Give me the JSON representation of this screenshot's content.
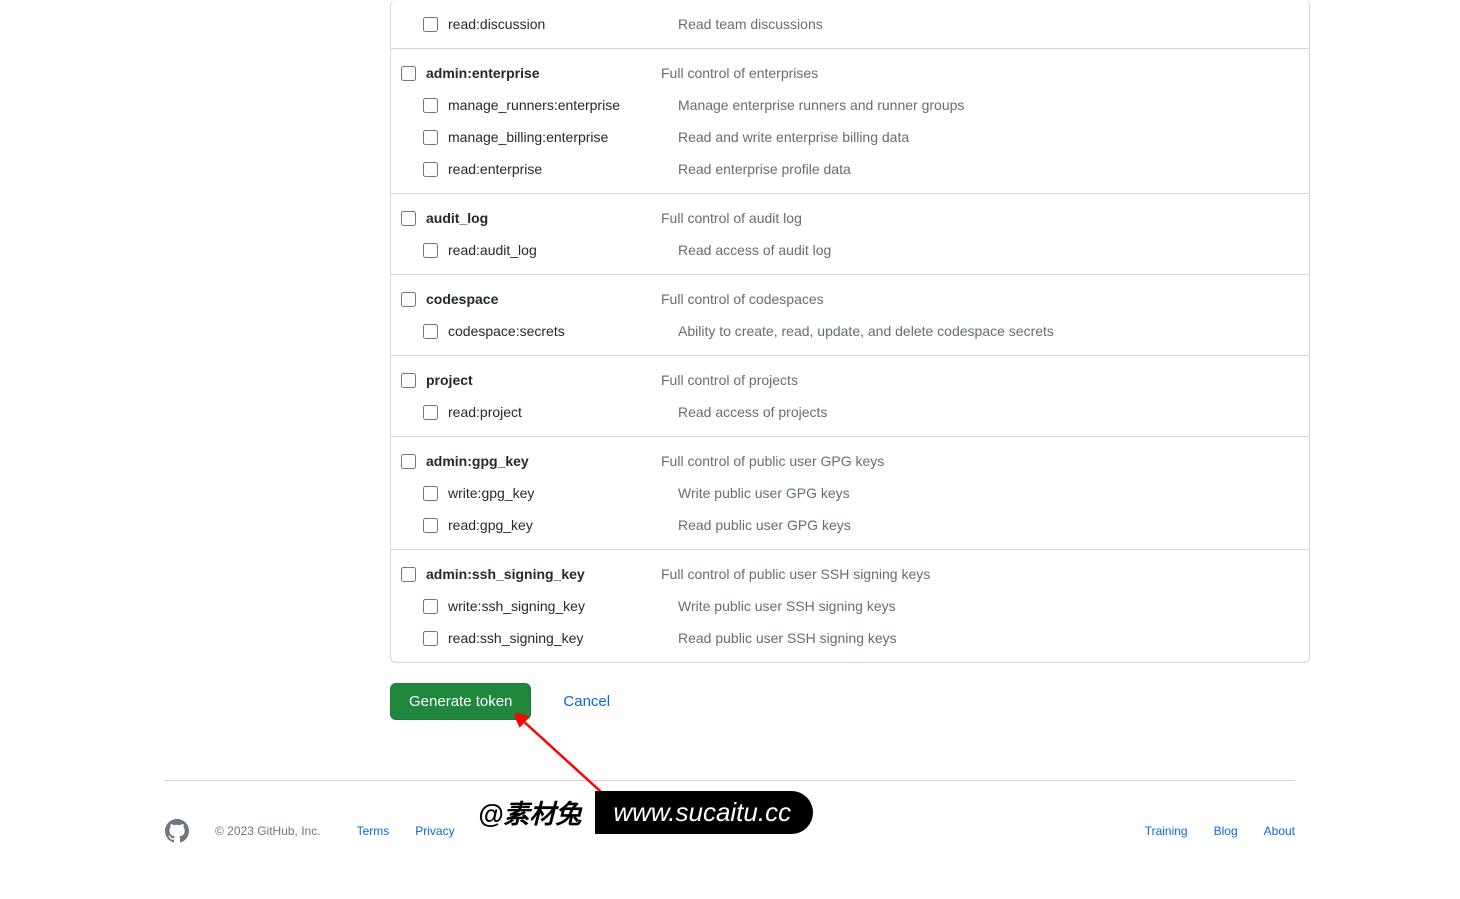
{
  "scope_groups": [
    {
      "parent": null,
      "children": [
        {
          "label": "read:discussion",
          "desc": "Read team discussions"
        }
      ]
    },
    {
      "parent": {
        "label": "admin:enterprise",
        "desc": "Full control of enterprises"
      },
      "children": [
        {
          "label": "manage_runners:enterprise",
          "desc": "Manage enterprise runners and runner groups"
        },
        {
          "label": "manage_billing:enterprise",
          "desc": "Read and write enterprise billing data"
        },
        {
          "label": "read:enterprise",
          "desc": "Read enterprise profile data"
        }
      ]
    },
    {
      "parent": {
        "label": "audit_log",
        "desc": "Full control of audit log"
      },
      "children": [
        {
          "label": "read:audit_log",
          "desc": "Read access of audit log"
        }
      ]
    },
    {
      "parent": {
        "label": "codespace",
        "desc": "Full control of codespaces"
      },
      "children": [
        {
          "label": "codespace:secrets",
          "desc": "Ability to create, read, update, and delete codespace secrets"
        }
      ]
    },
    {
      "parent": {
        "label": "project",
        "desc": "Full control of projects"
      },
      "children": [
        {
          "label": "read:project",
          "desc": "Read access of projects"
        }
      ]
    },
    {
      "parent": {
        "label": "admin:gpg_key",
        "desc": "Full control of public user GPG keys"
      },
      "children": [
        {
          "label": "write:gpg_key",
          "desc": "Write public user GPG keys"
        },
        {
          "label": "read:gpg_key",
          "desc": "Read public user GPG keys"
        }
      ]
    },
    {
      "parent": {
        "label": "admin:ssh_signing_key",
        "desc": "Full control of public user SSH signing keys"
      },
      "children": [
        {
          "label": "write:ssh_signing_key",
          "desc": "Write public user SSH signing keys"
        },
        {
          "label": "read:ssh_signing_key",
          "desc": "Read public user SSH signing keys"
        }
      ]
    }
  ],
  "actions": {
    "generate": "Generate token",
    "cancel": "Cancel"
  },
  "footer": {
    "copyright": "© 2023 GitHub, Inc.",
    "links_left": [
      "Terms",
      "Privacy"
    ],
    "links_right": [
      "Training",
      "Blog",
      "About"
    ]
  },
  "watermark": {
    "left": "@素材兔",
    "right": "www.sucaitu.cc"
  }
}
